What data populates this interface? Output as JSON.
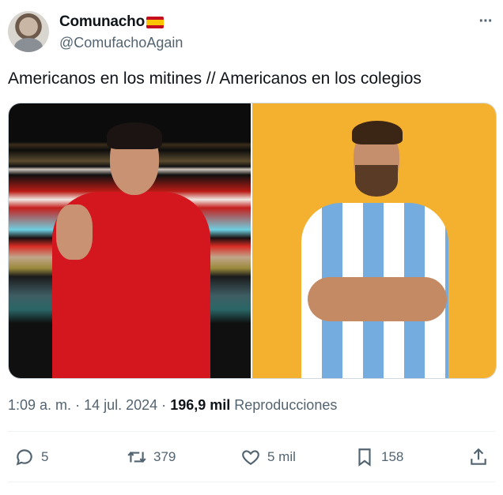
{
  "author": {
    "display_name": "Comunacho",
    "handle": "@ComufachoAgain",
    "flag_icon": "spain-flag"
  },
  "more_icon": "more-dots-icon",
  "tweet": {
    "text": "Americanos en los mitines // Americanos en los colegios"
  },
  "meta": {
    "time": "1:09 a. m.",
    "sep1": "·",
    "date": "14 jul. 2024",
    "sep2": "·",
    "views_count": "196,9 mil",
    "views_label": "Reproducciones"
  },
  "actions": {
    "reply_count": "5",
    "retweet_count": "379",
    "like_count": "5 mil",
    "bookmark_count": "158"
  },
  "colors": {
    "text": "#0f1419",
    "secondary": "#536471",
    "border": "#cfd9de"
  }
}
